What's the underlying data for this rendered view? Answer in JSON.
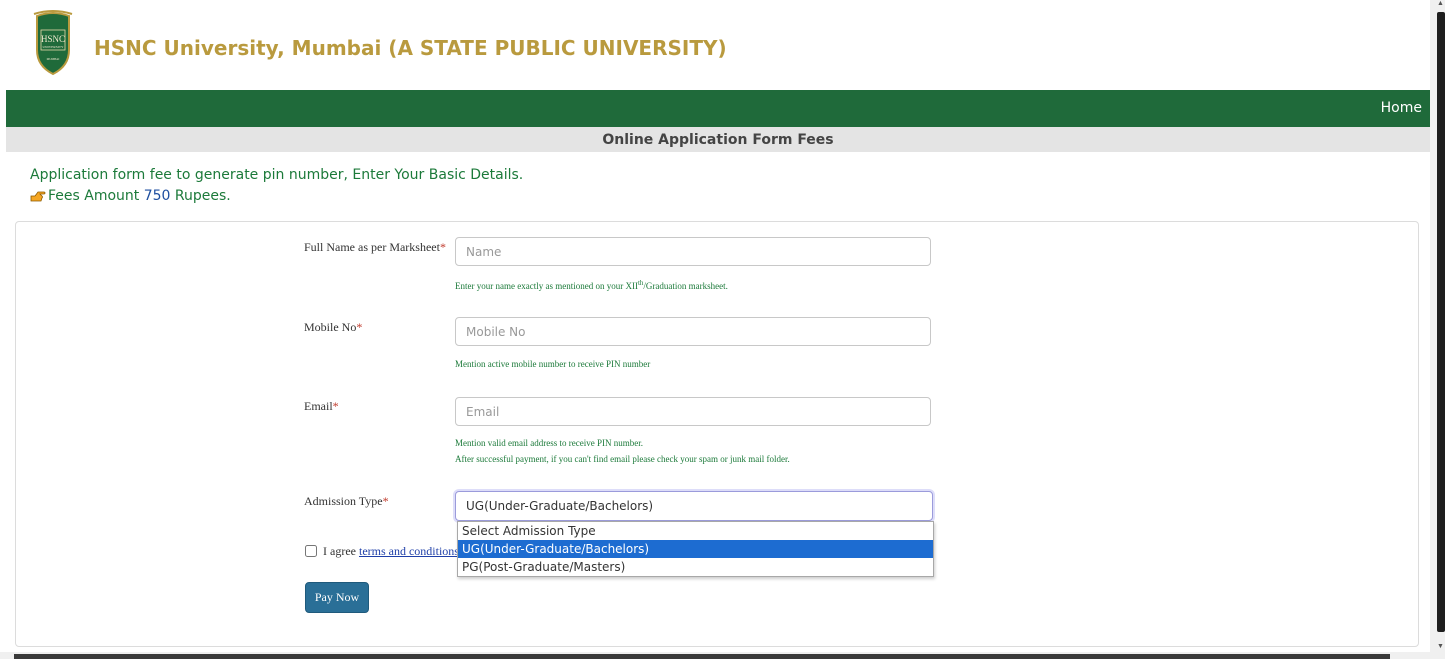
{
  "header": {
    "logo_text": "HSNC UNIVERSITY MUMBAI",
    "title": "HSNC University, Mumbai (A STATE PUBLIC UNIVERSITY)"
  },
  "nav": {
    "home_label": "Home"
  },
  "subtitle": "Online Application Form Fees",
  "info": {
    "line1": "Application form fee to generate pin number, Enter Your Basic Details.",
    "line2_prefix": "Fees Amount ",
    "amount": "750",
    "line2_suffix": " Rupees."
  },
  "form": {
    "name": {
      "label": "Full Name as per Marksheet",
      "required_mark": "*",
      "placeholder": "Name",
      "hint_prefix": "Enter your name exactly as mentioned on your XII",
      "hint_sup": "th",
      "hint_suffix": "/Graduation marksheet."
    },
    "mobile": {
      "label": "Mobile No",
      "required_mark": "*",
      "placeholder": "Mobile No",
      "hint": "Mention active mobile number to receive PIN number"
    },
    "email": {
      "label": "Email",
      "required_mark": "*",
      "placeholder": "Email",
      "hint1": "Mention valid email address to receive PIN number.",
      "hint2": "After successful payment, if you can't find email please check your spam or junk mail folder."
    },
    "admission": {
      "label": "Admission Type",
      "required_mark": "*",
      "selected": "UG(Under-Graduate/Bachelors)",
      "options": [
        "Select Admission Type",
        "UG(Under-Graduate/Bachelors)",
        "PG(Post-Graduate/Masters)"
      ]
    },
    "agree": {
      "prefix": "I agree ",
      "link": "terms and conditions"
    },
    "pay_button": "Pay Now"
  },
  "colors": {
    "brand_green": "#1f6a3a",
    "title_gold": "#b99a3e",
    "hint_green": "#1c7a3a",
    "button_blue": "#2a6f97",
    "selected_option": "#1d6cd1"
  }
}
